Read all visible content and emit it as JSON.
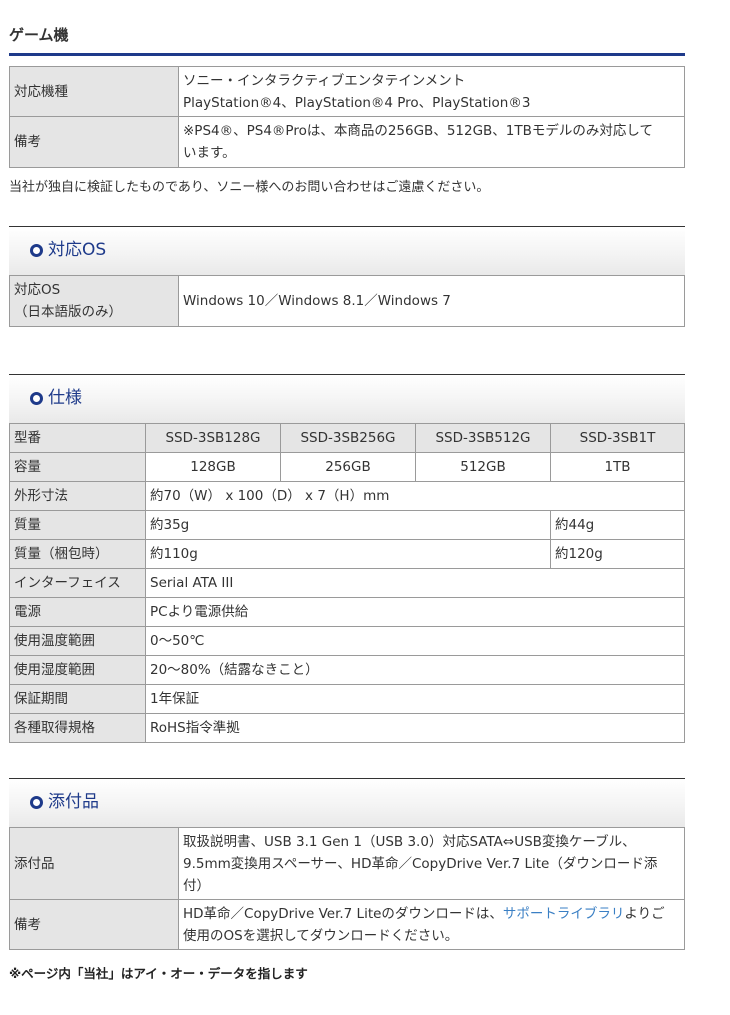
{
  "game": {
    "heading": "ゲーム機",
    "rows": [
      {
        "label": "対応機種",
        "line1": "ソニー・インタラクティブエンタテインメント",
        "line2": "PlayStation®4、PlayStation®4 Pro、PlayStation®3"
      },
      {
        "label": "備考",
        "line1": "※PS4®、PS4®Proは、本商品の256GB、512GB、1TBモデルのみ対応して",
        "line2": "います。"
      }
    ],
    "note": "当社が独自に検証したものであり、ソニー様へのお問い合わせはご遠慮ください。"
  },
  "os": {
    "heading": "対応OS",
    "label_line1": "対応OS",
    "label_line2": "（日本語版のみ）",
    "value": "Windows 10／Windows 8.1／Windows 7"
  },
  "spec": {
    "heading": "仕様",
    "model_label": "型番",
    "models": [
      "SSD-3SB128G",
      "SSD-3SB256G",
      "SSD-3SB512G",
      "SSD-3SB1T"
    ],
    "capacity_label": "容量",
    "capacities": [
      "128GB",
      "256GB",
      "512GB",
      "1TB"
    ],
    "dimensions_label": "外形寸法",
    "dimensions_value": "約70（W） x 100（D） x 7（H）mm",
    "weight_label": "質量",
    "weight_small": "約35g",
    "weight_large": "約44g",
    "weight_pkg_label": "質量（梱包時）",
    "weight_pkg_small": "約110g",
    "weight_pkg_large": "約120g",
    "interface_label": "インターフェイス",
    "interface_value": "Serial ATA III",
    "power_label": "電源",
    "power_value": "PCより電源供給",
    "temp_label": "使用温度範囲",
    "temp_value": "0～50℃",
    "humidity_label": "使用湿度範囲",
    "humidity_value": "20～80%（結露なきこと）",
    "warranty_label": "保証期間",
    "warranty_value": "1年保証",
    "standards_label": "各種取得規格",
    "standards_value": "RoHS指令準拠"
  },
  "accessories": {
    "heading": "添付品",
    "label": "添付品",
    "line1": "取扱説明書、USB 3.1 Gen 1（USB 3.0）対応SATA⇔USB変換ケーブル、",
    "line2": "9.5mm変換用スペーサー、HD革命／CopyDrive Ver.7 Lite（ダウンロード添",
    "line3": "付）",
    "remarks_label": "備考",
    "remarks_pre": "HD革命／CopyDrive Ver.7 Liteのダウンロードは、",
    "remarks_link": "サポートライブラリ",
    "remarks_post": "よりご",
    "remarks_line2": "使用のOSを選択してダウンロードください。"
  },
  "footer": "※ページ内「当社」はアイ・オー・データを指します",
  "colors": {
    "accent": "#1e3a8a",
    "label_bg": "#e5e5e5",
    "border": "#9a9a9a",
    "link": "#3a7fc4"
  }
}
